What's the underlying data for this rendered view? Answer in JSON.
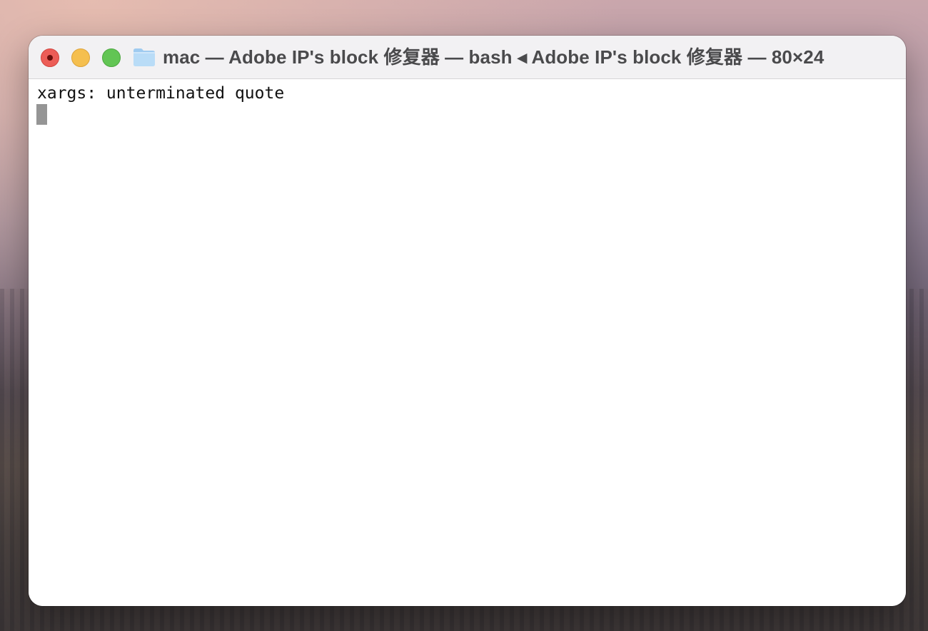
{
  "window": {
    "title": "mac — Adobe IP's block 修复器 — bash ◂ Adobe IP's block 修复器 — 80×24",
    "title_icon": "folder-icon",
    "controls": {
      "close_color": "#ec5d57",
      "minimize_color": "#f5bf4f",
      "zoom_color": "#62c554"
    }
  },
  "terminal": {
    "lines": [
      "xargs: unterminated quote"
    ],
    "cursor_color": "#959595"
  }
}
